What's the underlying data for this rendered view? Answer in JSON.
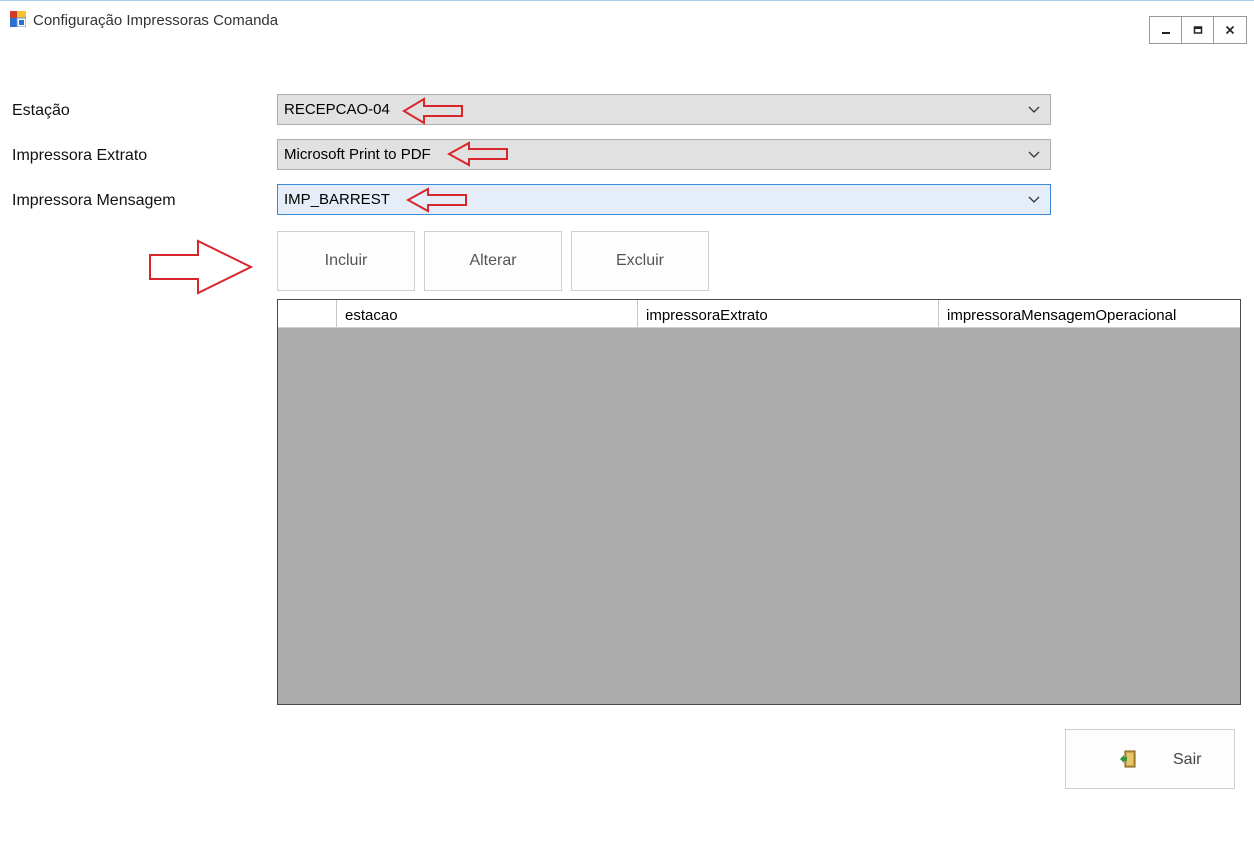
{
  "window": {
    "title": "Configuração Impressoras Comanda",
    "icon": "app-icon",
    "controls": [
      "minimize-icon",
      "maximize-icon",
      "close-icon"
    ]
  },
  "form": {
    "fields": [
      {
        "label": "Estação",
        "value": "RECEPCAO-04"
      },
      {
        "label": "Impressora Extrato",
        "value": "Microsoft Print to PDF"
      },
      {
        "label": "Impressora Mensagem",
        "value": "IMP_BARREST"
      }
    ]
  },
  "actions": {
    "incluir": "Incluir",
    "alterar": "Alterar",
    "excluir": "Excluir"
  },
  "grid": {
    "columns": [
      "estacao",
      "impressoraExtrato",
      "impressoraMensagemOperacional"
    ],
    "rows": []
  },
  "footer": {
    "exit_label": "Sair",
    "exit_icon": "exit-door-icon"
  },
  "colors": {
    "annotation_arrow": "#d9262b",
    "combo_background": "#e1e1e1",
    "combo_focused_background": "#e5eef8",
    "combo_focused_border": "#3b8ad6",
    "grid_background": "#ababab"
  }
}
